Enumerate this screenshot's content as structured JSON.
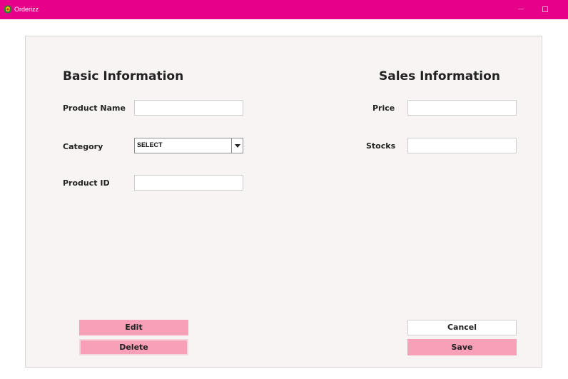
{
  "window": {
    "title": "Orderizz",
    "minimize_glyph": "—"
  },
  "basic_info": {
    "heading": "Basic Information",
    "product_name": {
      "label": "Product Name",
      "value": ""
    },
    "category": {
      "label": "Category",
      "selected": "SELECT"
    },
    "product_id": {
      "label": "Product ID",
      "value": ""
    }
  },
  "sales_info": {
    "heading": "Sales Information",
    "price": {
      "label": "Price",
      "value": ""
    },
    "stocks": {
      "label": "Stocks",
      "value": ""
    }
  },
  "buttons": {
    "edit": "Edit",
    "delete": "Delete",
    "cancel": "Cancel",
    "save": "Save"
  },
  "colors": {
    "titlebar": "#e6008a",
    "button_pink": "#f9a0b9",
    "panel": "#f8f4f3"
  }
}
